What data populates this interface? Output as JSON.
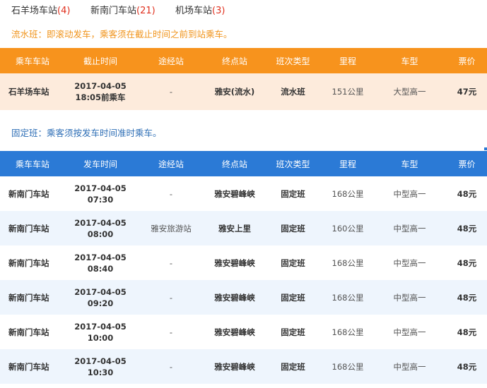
{
  "tabs": [
    {
      "label": "石羊场车站",
      "count": "(4)"
    },
    {
      "label": "新南门车站",
      "count": "(21)"
    },
    {
      "label": "机场车站",
      "count": "(3)"
    }
  ],
  "notices": {
    "flow": "流水班：即滚动发车，乘客须在截止时间之前到站乘车。",
    "fixed": "固定班：乘客须按发车时间准时乘车。"
  },
  "flow_table": {
    "headers": [
      "乘车车站",
      "截止时间",
      "途经站",
      "终点站",
      "班次类型",
      "里程",
      "车型",
      "票价"
    ],
    "rows": [
      {
        "station": "石羊场车站",
        "date": "2017-04-05",
        "time": "18:05前乘车",
        "via": "-",
        "dest": "雅安(流水)",
        "type": "流水班",
        "distance": "151公里",
        "vehicle": "大型高一",
        "price": "47元"
      }
    ]
  },
  "fixed_table": {
    "headers": [
      "乘车车站",
      "发车时间",
      "途经站",
      "终点站",
      "班次类型",
      "里程",
      "车型",
      "票价"
    ],
    "rows": [
      {
        "station": "新南门车站",
        "date": "2017-04-05",
        "time": "07:30",
        "via": "-",
        "dest": "雅安碧峰峡",
        "type": "固定班",
        "distance": "168公里",
        "vehicle": "中型高一",
        "price": "48元"
      },
      {
        "station": "新南门车站",
        "date": "2017-04-05",
        "time": "08:00",
        "via": "雅安旅游站",
        "dest": "雅安上里",
        "type": "固定班",
        "distance": "160公里",
        "vehicle": "中型高一",
        "price": "48元"
      },
      {
        "station": "新南门车站",
        "date": "2017-04-05",
        "time": "08:40",
        "via": "-",
        "dest": "雅安碧峰峡",
        "type": "固定班",
        "distance": "168公里",
        "vehicle": "中型高一",
        "price": "48元"
      },
      {
        "station": "新南门车站",
        "date": "2017-04-05",
        "time": "09:20",
        "via": "-",
        "dest": "雅安碧峰峡",
        "type": "固定班",
        "distance": "168公里",
        "vehicle": "中型高一",
        "price": "48元"
      },
      {
        "station": "新南门车站",
        "date": "2017-04-05",
        "time": "10:00",
        "via": "-",
        "dest": "雅安碧峰峡",
        "type": "固定班",
        "distance": "168公里",
        "vehicle": "中型高一",
        "price": "48元"
      },
      {
        "station": "新南门车站",
        "date": "2017-04-05",
        "time": "10:30",
        "via": "-",
        "dest": "雅安碧峰峡",
        "type": "固定班",
        "distance": "168公里",
        "vehicle": "中型高一",
        "price": "48元"
      }
    ]
  },
  "colors": {
    "flow_header": "#f7931d",
    "flow_row": "#fdebdc",
    "fixed_header": "#2b7ad6",
    "fixed_row_alt": "#eef5fd",
    "count": "#e0301e",
    "notice_orange": "#f0941c",
    "notice_blue": "#2f6fb6"
  }
}
